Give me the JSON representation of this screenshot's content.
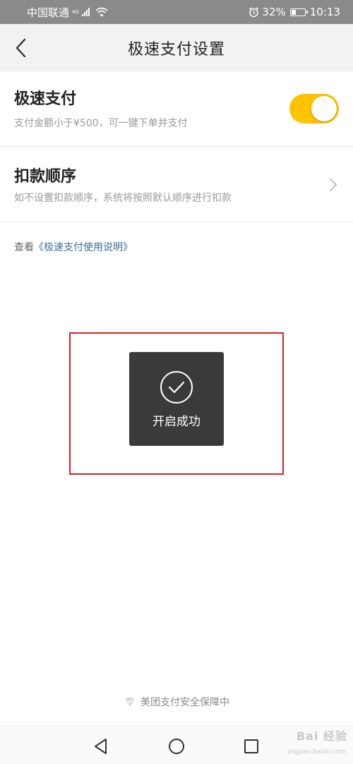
{
  "status_bar": {
    "carrier": "中国联通",
    "network": "4G",
    "battery": "32%",
    "time": "10:13"
  },
  "nav": {
    "title": "极速支付设置"
  },
  "quick_pay": {
    "title": "极速支付",
    "subtitle": "支付金额小于¥500，可一键下单并支付",
    "enabled": true,
    "toggle_color": "#ffc300"
  },
  "deduction_order": {
    "title": "扣款顺序",
    "subtitle": "如不设置扣款顺序，系统将按照默认顺序进行扣款"
  },
  "help": {
    "prefix": "查看",
    "link": "《极速支付使用说明》"
  },
  "toast": {
    "text": "开启成功"
  },
  "footer": {
    "security_note": "美团支付安全保障中"
  },
  "watermark": {
    "text": "Bai 经验",
    "sub": "jingyan.baidu.com"
  },
  "colors": {
    "highlight_border": "#d2232a",
    "link": "#3b6e9c"
  }
}
